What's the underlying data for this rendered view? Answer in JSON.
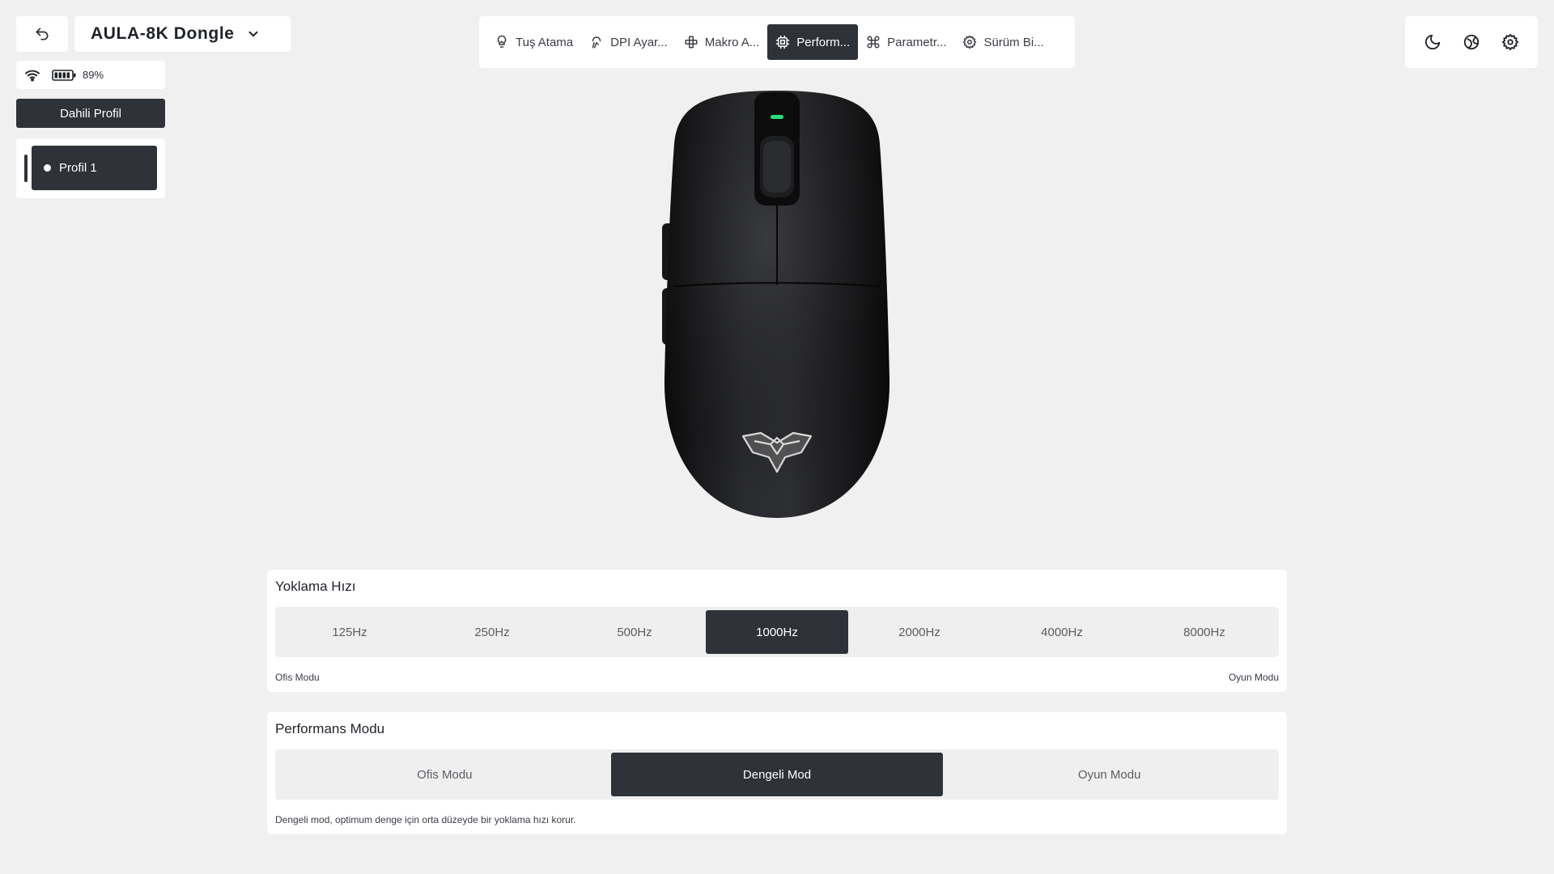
{
  "header": {
    "device_name": "AULA-8K Dongle",
    "battery_percent": "89%"
  },
  "sidebar": {
    "profile_header": "Dahili Profil",
    "profiles": [
      {
        "label": "Profil 1",
        "active": true
      }
    ]
  },
  "tabs": [
    {
      "label": "Tuş Atama",
      "icon": "key-bulb-icon",
      "active": false
    },
    {
      "label": "DPI Ayar...",
      "icon": "dpi-icon",
      "active": false
    },
    {
      "label": "Makro A...",
      "icon": "macro-icon",
      "active": false
    },
    {
      "label": "Perform...",
      "icon": "chip-icon",
      "active": true
    },
    {
      "label": "Parametr...",
      "icon": "command-icon",
      "active": false
    },
    {
      "label": "Sürüm Bi...",
      "icon": "gear-icon",
      "active": false
    }
  ],
  "tools": [
    "moon-icon",
    "language-icon",
    "settings-icon"
  ],
  "polling": {
    "title": "Yoklama Hızı",
    "options": [
      "125Hz",
      "250Hz",
      "500Hz",
      "1000Hz",
      "2000Hz",
      "4000Hz",
      "8000Hz"
    ],
    "selected": "1000Hz",
    "left_label": "Ofis Modu",
    "right_label": "Oyun Modu"
  },
  "performance": {
    "title": "Performans Modu",
    "options": [
      "Ofis Modu",
      "Dengeli Mod",
      "Oyun Modu"
    ],
    "selected": "Dengeli Mod",
    "description": "Dengeli mod, optimum denge için orta düzeyde bir yoklama hızı korur."
  },
  "colors": {
    "accent_dark": "#2f3239",
    "background": "#f0f0f0",
    "led": "#28e07a"
  }
}
